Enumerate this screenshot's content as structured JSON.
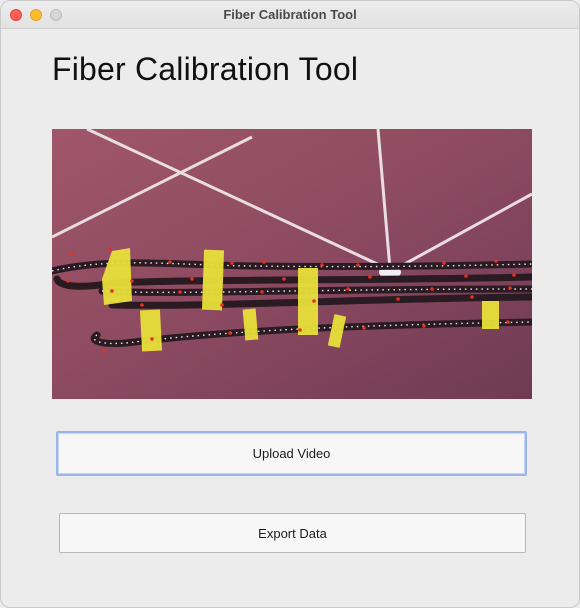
{
  "window": {
    "title": "Fiber Calibration Tool"
  },
  "main": {
    "heading": "Fiber Calibration Tool",
    "preview_alt": "Video frame of LED fiber strips taped to a wall",
    "upload_button": "Upload Video",
    "export_button": "Export Data"
  },
  "colors": {
    "upload_focus_ring": "#9ab6e8",
    "tape": "#e8e03a",
    "led_marker": "#e2321f",
    "wall": "#8e4e62"
  }
}
